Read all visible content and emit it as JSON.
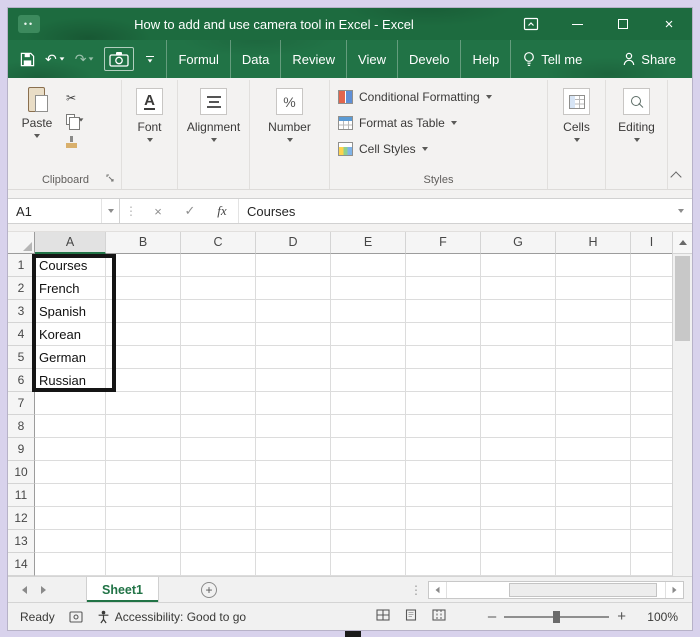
{
  "window": {
    "title": "How to add and use camera tool in Excel - Excel"
  },
  "ribbon_tabs": {
    "items": [
      {
        "label": "Formul"
      },
      {
        "label": "Data"
      },
      {
        "label": "Review"
      },
      {
        "label": "View"
      },
      {
        "label": "Develo"
      },
      {
        "label": "Help"
      }
    ],
    "tell_me": "Tell me",
    "share": "Share"
  },
  "ribbon": {
    "clipboard": {
      "paste_label": "Paste",
      "group_label": "Clipboard"
    },
    "font": {
      "icon_text": "A",
      "label": "Font"
    },
    "alignment": {
      "label": "Alignment"
    },
    "number": {
      "icon_text": "%",
      "label": "Number"
    },
    "styles": {
      "buttons": [
        {
          "label": "Conditional Formatting"
        },
        {
          "label": "Format as Table"
        },
        {
          "label": "Cell Styles"
        }
      ],
      "group_label": "Styles"
    },
    "cells": {
      "label": "Cells"
    },
    "editing": {
      "label": "Editing"
    }
  },
  "formula_bar": {
    "name_box": "A1",
    "fx_label": "fx",
    "value": "Courses"
  },
  "grid": {
    "columns": [
      "A",
      "B",
      "C",
      "D",
      "E",
      "F",
      "G",
      "H",
      "I"
    ],
    "rows": [
      "1",
      "2",
      "3",
      "4",
      "5",
      "6",
      "7",
      "8",
      "9",
      "10",
      "11",
      "12",
      "13",
      "14"
    ],
    "column_a_values": [
      "Courses",
      "French",
      "Spanish",
      "Korean",
      "German",
      "Russian"
    ],
    "active_cell": "A1"
  },
  "sheet_bar": {
    "active_tab": "Sheet1",
    "new_sheet": "+"
  },
  "status_bar": {
    "mode": "Ready",
    "accessibility": "Accessibility: Good to go",
    "zoom_out": "–",
    "zoom_in": "+",
    "zoom_level": "100%"
  },
  "icons": {
    "app_dots": "••",
    "undo": "↶",
    "redo": "↷",
    "cut": "✂",
    "cancel": "×",
    "check": "✓",
    "close": "×",
    "grip_dots": "⋮"
  },
  "colors": {
    "excel_green": "#217346",
    "title_green": "#1d6b3f",
    "annotation_border": "#151515",
    "desktop_background": "#d8d2ec"
  }
}
